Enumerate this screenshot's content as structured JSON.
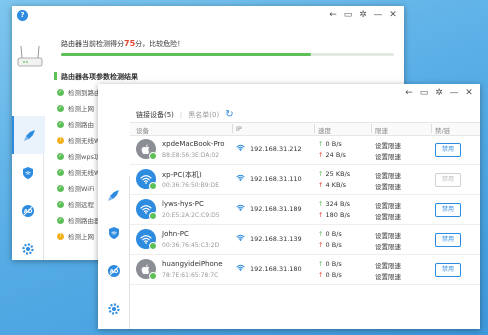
{
  "colors": {
    "accent": "#2d8be0",
    "ok": "#5cbf57",
    "danger": "#e2472f",
    "warn": "#f2b01e"
  },
  "back_window": {
    "score_prefix": "路由器当前检测得分",
    "score_value": "75",
    "score_suffix": "分，比较危险！",
    "score_progress": 0.75,
    "check_title": "路由器各项参数检测结果",
    "checks": [
      {
        "label": "检测到路由器",
        "status": "ok"
      },
      {
        "label": "检测上网",
        "status": "ok"
      },
      {
        "label": "检测路由",
        "status": "ok"
      },
      {
        "label": "检测无线W",
        "status": "warn"
      },
      {
        "label": "检测wps功",
        "status": "ok"
      },
      {
        "label": "检测无线W",
        "status": "ok"
      },
      {
        "label": "检测WiFi",
        "status": "ok"
      },
      {
        "label": "检测远程",
        "status": "ok"
      },
      {
        "label": "检测路由器",
        "status": "ok"
      },
      {
        "label": "检测上网",
        "status": "warn"
      }
    ],
    "sidebar": [
      "rocket-icon",
      "shield-wifi-icon",
      "ad-block-icon",
      "gear-icon"
    ]
  },
  "front_window": {
    "tab_linked": "链接设备",
    "tab_linked_count": "(5)",
    "tab_blacklist": "黑名单",
    "tab_blacklist_count": "(0)",
    "columns": [
      "设备",
      "IP",
      "速度",
      "限速",
      "禁/链"
    ],
    "devices": [
      {
        "name": "xpdeMacBook-Pro",
        "mac": "B8:E8:56:3E:DA:02",
        "ip": "192.168.31.212",
        "up": "0 B/s",
        "down": "24 B/s",
        "limit": "设置限速",
        "action": "禁用",
        "avatar": "apple",
        "action_enabled": true
      },
      {
        "name": "xp-PC(本机)",
        "mac": "00:36:76:50:B9:DE",
        "ip": "192.168.31.110",
        "up": "25 KB/s",
        "down": "4 KB/s",
        "limit": "设置限速",
        "action": "禁用",
        "avatar": "wifi",
        "action_enabled": false
      },
      {
        "name": "lyws-hys-PC",
        "mac": "20:E5:2A:2C:C9:D5",
        "ip": "192.168.31.189",
        "up": "324 B/s",
        "down": "180 B/s",
        "limit": "设置限速",
        "action": "禁用",
        "avatar": "wifi",
        "action_enabled": true
      },
      {
        "name": "John-PC",
        "mac": "00:36:76:45:C3:2D",
        "ip": "192.168.31.139",
        "up": "0 B/s",
        "down": "0 B/s",
        "limit": "设置限速",
        "action": "禁用",
        "avatar": "wifi",
        "action_enabled": true
      },
      {
        "name": "huangyideiPhone",
        "mac": "78:7E:61:65:78:7C",
        "ip": "192.168.31.180",
        "up": "0 B/s",
        "down": "0 B/s",
        "limit": "设置限速",
        "action": "禁用",
        "avatar": "apple",
        "action_enabled": true
      }
    ],
    "sidebar": [
      "rocket-icon",
      "shield-wifi-icon",
      "ad-block-icon",
      "gear-icon"
    ]
  },
  "ad_badge": "AD"
}
